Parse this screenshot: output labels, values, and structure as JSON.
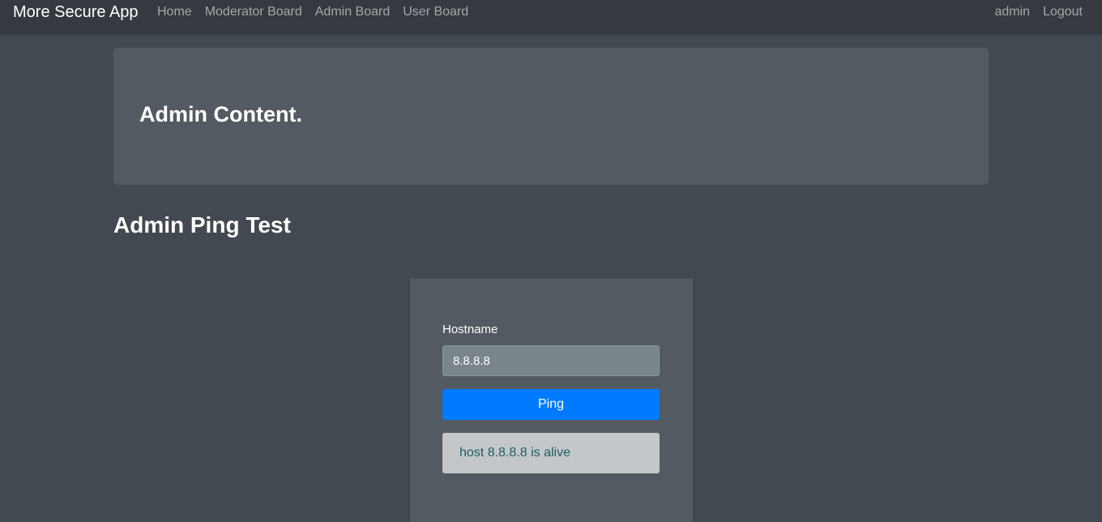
{
  "navbar": {
    "brand": "More Secure App",
    "links": [
      "Home",
      "Moderator Board",
      "Admin Board",
      "User Board"
    ],
    "user": "admin",
    "logout": "Logout"
  },
  "jumbotron": {
    "heading": "Admin Content."
  },
  "section": {
    "title": "Admin Ping Test"
  },
  "ping_form": {
    "hostname_label": "Hostname",
    "hostname_value": "8.8.8.8",
    "button_label": "Ping",
    "result": "host 8.8.8.8 is alive"
  },
  "colors": {
    "navbar_bg": "#343a40",
    "page_bg": "#424950",
    "panel_bg": "#535a61",
    "primary": "#007bff",
    "alert_bg": "#c3c7ca",
    "alert_text": "#1e5f5b"
  }
}
